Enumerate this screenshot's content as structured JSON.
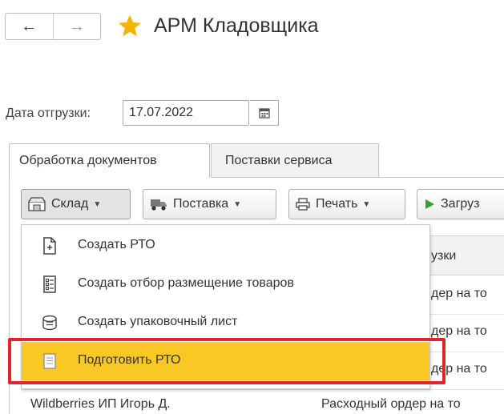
{
  "nav": {
    "back_icon": "arrow-left-icon",
    "forward_icon": "arrow-right-icon"
  },
  "header": {
    "title": "АРМ Кладовщика",
    "star_icon": "star-icon",
    "star_color": "#f5b400"
  },
  "date": {
    "label": "Дата отгрузки:",
    "value": "17.07.2022",
    "calendar_icon": "calendar-icon"
  },
  "tabs": [
    {
      "label": "Обработка документов",
      "active": true
    },
    {
      "label": "Поставки сервиса",
      "active": false
    }
  ],
  "toolbar": {
    "sklad_label": "Склад",
    "postavka_label": "Поставка",
    "pechat_label": "Печать",
    "zagruz_label": "Загруз"
  },
  "table": {
    "header_fragment": "узки",
    "rows": [
      {
        "col2": "дер на то"
      },
      {
        "col2": "дер на то"
      },
      {
        "col2": "дер на то"
      },
      {
        "col1": "Wildberries ИП Игорь Д.",
        "col2": "Расходный ордер на то"
      }
    ]
  },
  "menu": {
    "items": [
      {
        "label": "Создать РТО",
        "icon": "document-add-icon"
      },
      {
        "label": "Создать отбор размещение товаров",
        "icon": "list-icon"
      },
      {
        "label": "Создать упаковочный лист",
        "icon": "package-icon"
      },
      {
        "label": "Подготовить РТО",
        "icon": "document-icon",
        "highlighted": true
      }
    ],
    "highlight_color": "#f8c824",
    "annotation_color": "#e3242b"
  }
}
